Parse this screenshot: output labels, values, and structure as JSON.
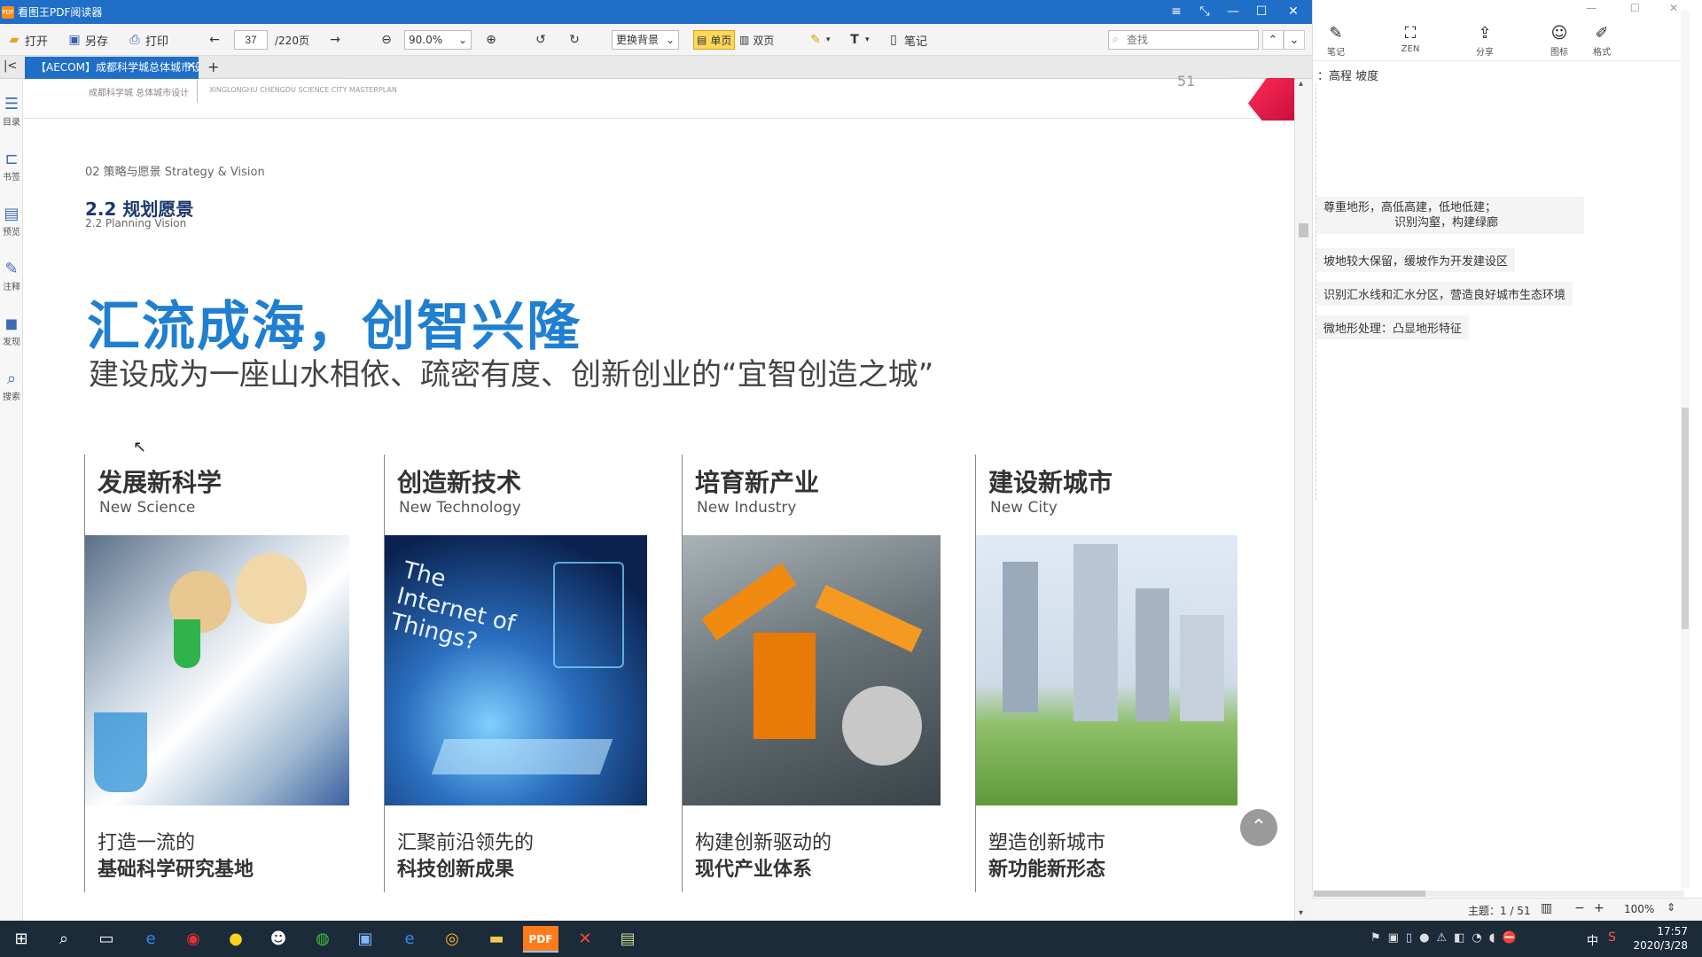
{
  "window": {
    "title": "看图王PDF阅读器",
    "logo_text": "PDF"
  },
  "toolbar": {
    "open": "打开",
    "saveas": "另存",
    "print": "打印",
    "page_current": "37",
    "page_total": "/220页",
    "zoom": "90.0%",
    "background": "更换背景",
    "single_page": "单页",
    "double_page": "双页",
    "notes": "笔记",
    "search_placeholder": "查找"
  },
  "tab": {
    "label": "【AECOM】成都科学城总体城市设计",
    "close": "×",
    "add": "+"
  },
  "left_sidebar": {
    "items": [
      {
        "label": "目录",
        "glyph": "☰"
      },
      {
        "label": "书签",
        "glyph": "⊏"
      },
      {
        "label": "预览",
        "glyph": "▤"
      },
      {
        "label": "注释",
        "glyph": "✎"
      },
      {
        "label": "发现",
        "glyph": "◼"
      },
      {
        "label": "搜索",
        "glyph": "⌕"
      }
    ]
  },
  "document": {
    "header_left": "成都科学城 总体城市设计",
    "header_sub": "XINGLONGHU CHENGDU SCIENCE CITY MASTERPLAN",
    "page_number": "51",
    "section_label": "02 策略与愿景  Strategy & Vision",
    "section_title": "2.2 规划愿景",
    "section_sub": "2.2 Planning Vision",
    "headline": "汇流成海，创智兴隆",
    "subline": "建设成为一座山水相依、疏密有度、创新创业的“宜智创造之城”",
    "columns": [
      {
        "title": "发展新科学",
        "english": "New Science",
        "line1": "打造一流的",
        "line2": "基础科学研究基地"
      },
      {
        "title": "创造新技术",
        "english": "New Technology",
        "line1": "汇聚前沿领先的",
        "line2": "科技创新成果",
        "image_text": "The Internet of Things?"
      },
      {
        "title": "培育新产业",
        "english": "New Industry",
        "line1": "构建创新驱动的",
        "line2": "现代产业体系"
      },
      {
        "title": "建设新城市",
        "english": "New City",
        "line1": "塑造创新城市",
        "line2": "新功能新形态"
      }
    ]
  },
  "right_panel": {
    "tools": [
      {
        "label": "笔记",
        "glyph": "✎"
      },
      {
        "label": "ZEN",
        "glyph": "⛶"
      },
      {
        "label": "分享",
        "glyph": "⇪"
      },
      {
        "label": "图标",
        "glyph": "☺"
      },
      {
        "label": "格式",
        "glyph": "✐"
      }
    ],
    "top_text": "：高程 坡度",
    "notes": [
      "尊重地形，高低高建，低地低建；",
      "识别沟壑，构建绿廊",
      "坡地较大保留，缓坡作为开发建设区",
      "识别汇水线和汇水分区，营造良好城市生态环境",
      "微地形处理：凸显地形特征"
    ],
    "status_theme": "主题：1 / 51",
    "zoom": "100%"
  },
  "taskbar": {
    "time": "17:57",
    "date": "2020/3/28",
    "ime": "中"
  }
}
